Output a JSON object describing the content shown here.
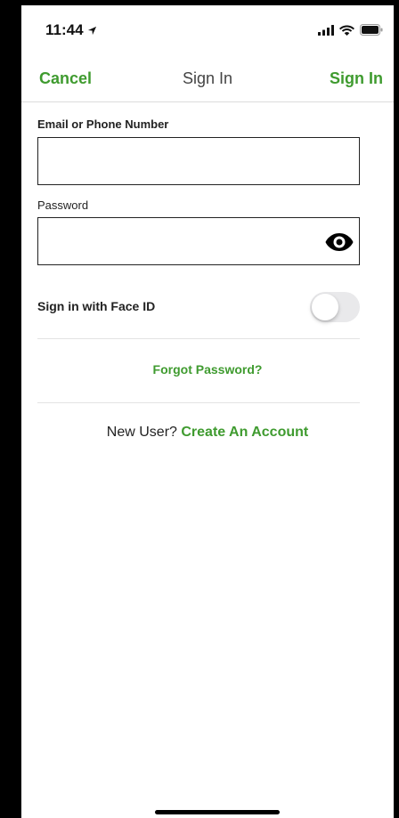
{
  "status_bar": {
    "time": "11:44",
    "location_icon": "location-arrow-icon",
    "signal_icon": "cellular-signal-icon",
    "wifi_icon": "wifi-icon",
    "battery_icon": "battery-icon"
  },
  "nav": {
    "cancel_label": "Cancel",
    "title": "Sign In",
    "sign_in_label": "Sign In"
  },
  "form": {
    "email_label": "Email or Phone Number",
    "email_value": "",
    "password_label": "Password",
    "password_value": "",
    "show_password_icon": "eye-icon",
    "face_id_label": "Sign in with Face ID",
    "face_id_enabled": false
  },
  "links": {
    "forgot_password": "Forgot Password?",
    "new_user_prefix": "New User?",
    "create_account": "Create An Account"
  },
  "colors": {
    "accent": "#3f9b2f",
    "text": "#222222",
    "divider": "#e3e3e3"
  }
}
